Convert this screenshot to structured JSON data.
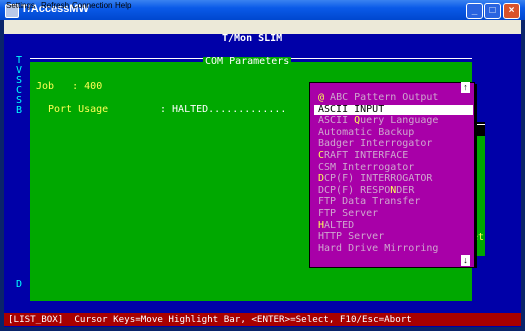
{
  "window": {
    "title": "T/AccessMW",
    "minimize": "_",
    "maximize": "□",
    "close": "×"
  },
  "menu": [
    "Settings",
    "Refresh",
    "Connection",
    "Help"
  ],
  "terminal": {
    "app_name": "T/Mon SLIM",
    "side_letters": [
      "T",
      "V",
      "S",
      "C",
      "S",
      "B"
    ],
    "bottom_letter": "D",
    "panel_title": "COM Parameters",
    "job_label": "Job",
    "job_value": ": 400",
    "port_label": "Port Usage",
    "port_value": ": HALTED.............",
    "right_panel_text": "et"
  },
  "listbox": {
    "scroll_up": "↑",
    "scroll_down": "↓",
    "items": [
      {
        "hot": "@",
        "rest": " ABC Pattern Output",
        "selected": false
      },
      {
        "hot": "",
        "rest": "ASCII INPUT",
        "selected": true
      },
      {
        "hot": "",
        "pre": "ASCII ",
        "hotmid": "Q",
        "post": "uery Language",
        "selected": false
      },
      {
        "hot": "",
        "rest": "Automatic Backup",
        "selected": false
      },
      {
        "hot": "",
        "rest": "Badger Interrogator",
        "selected": false
      },
      {
        "hot": "C",
        "rest": "RAFT INTERFACE",
        "selected": false
      },
      {
        "hot": "",
        "rest": "CSM Interrogator",
        "selected": false
      },
      {
        "hot": "D",
        "rest": "CP(F) INTERROGATOR",
        "selected": false
      },
      {
        "hot": "",
        "pre": "DCP(F) RESPO",
        "hotmid": "N",
        "post": "DER",
        "selected": false
      },
      {
        "hot": "",
        "rest": "FTP Data Transfer",
        "selected": false
      },
      {
        "hot": "",
        "rest": "FTP Server",
        "selected": false
      },
      {
        "hot": "H",
        "rest": "ALTED",
        "selected": false
      },
      {
        "hot": "",
        "rest": "HTTP Server",
        "selected": false
      },
      {
        "hot": "",
        "rest": "Hard Drive Mirroring",
        "selected": false
      }
    ]
  },
  "status_bar": "[LIST_BOX]  Cursor Keys=Move Highlight Bar, <ENTER>=Select, F10/Esc=Abort"
}
